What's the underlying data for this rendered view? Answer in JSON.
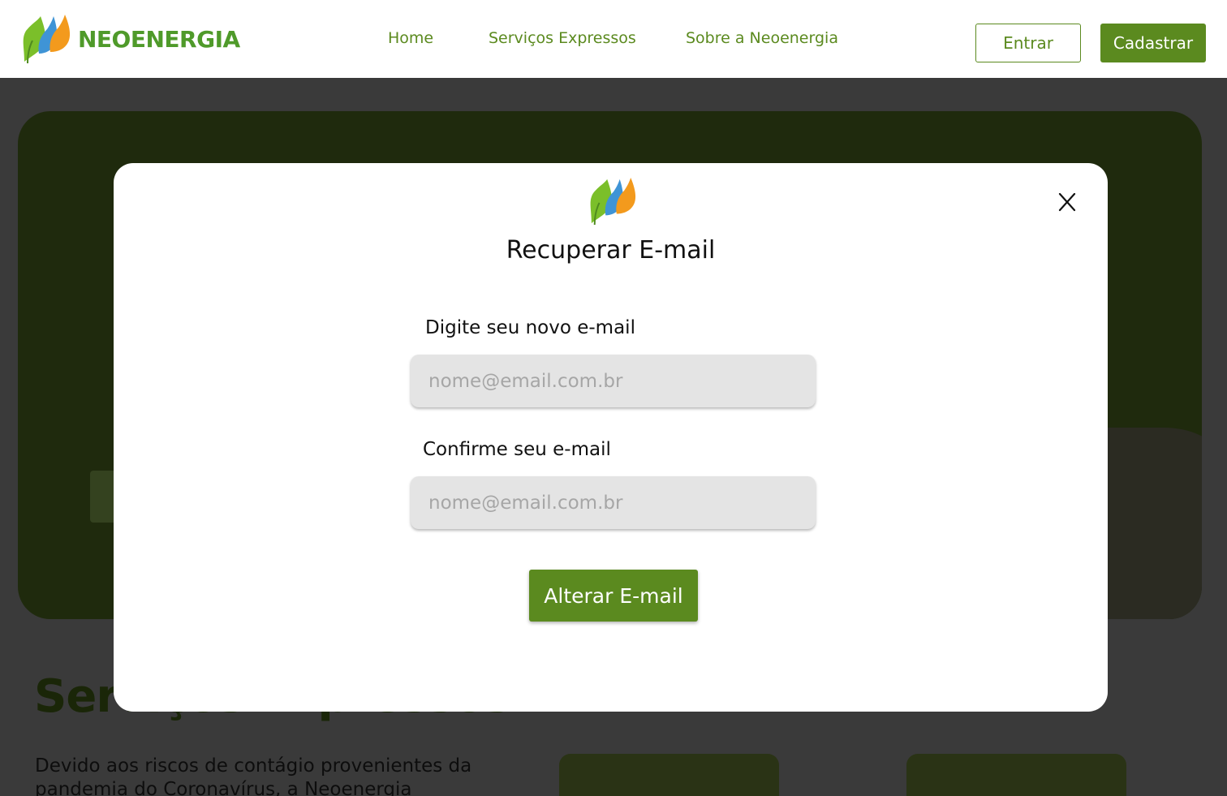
{
  "header": {
    "brand_name": "NEOENERGIA",
    "logo_icon": "neoenergia-leaves-logo",
    "nav": [
      {
        "label": "Home"
      },
      {
        "label": "Serviços Expressos"
      },
      {
        "label": "Sobre a Neoenergia"
      }
    ],
    "login_label": "Entrar",
    "signup_label": "Cadastrar"
  },
  "background": {
    "section_title": "Serviços Expressos",
    "section_text": "Devido aos riscos de contágio provenientes da pandemia do Coronavírus, a Neoenergia"
  },
  "modal": {
    "logo_icon": "neoenergia-leaves-logo",
    "title": "Recuperar E-mail",
    "close_label": "X",
    "new_email": {
      "label": "Digite seu novo e-mail",
      "placeholder": "nome@email.com.br",
      "value": ""
    },
    "confirm_email": {
      "label": "Confirme seu e-mail",
      "placeholder": "nome@email.com.br",
      "value": ""
    },
    "submit_label": "Alterar E-mail"
  },
  "colors": {
    "brand_green": "#5b8a1f",
    "logo_green": "#4f9a2a",
    "logo_blue": "#3f94d6",
    "logo_orange": "#f39a1d",
    "overlay": "#3a3a3a"
  }
}
